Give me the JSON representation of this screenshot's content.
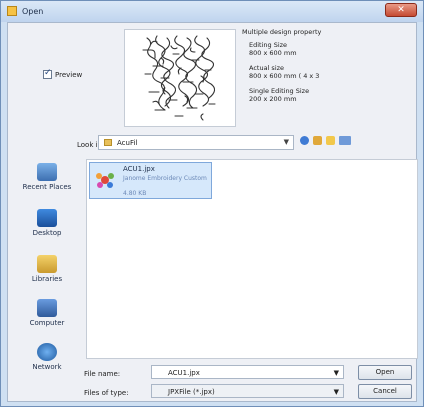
{
  "window": {
    "title": "Open",
    "close_label": "✕"
  },
  "preview": {
    "label": "Preview",
    "checked": true
  },
  "design_info": {
    "heading": "Multiple design property",
    "editing_size_label": "Editing Size",
    "editing_size_value": "800 x 600 mm",
    "actual_size_label": "Actual size",
    "actual_size_value": "800 x 600 mm ( 4 x 3",
    "single_size_label": "Single Editing Size",
    "single_size_value": "200 x 200 mm"
  },
  "lookin": {
    "label": "Look in:",
    "value": "AcuFil"
  },
  "places": [
    {
      "label": "Recent Places",
      "icon": "recent-places-icon"
    },
    {
      "label": "Desktop",
      "icon": "desktop-icon"
    },
    {
      "label": "Libraries",
      "icon": "libraries-icon"
    },
    {
      "label": "Computer",
      "icon": "computer-icon"
    },
    {
      "label": "Network",
      "icon": "network-icon"
    }
  ],
  "files": [
    {
      "name": "ACU1.jpx",
      "type": "Janome Embroidery Custom",
      "size": "4.80 KB"
    }
  ],
  "file_name": {
    "label": "File name:",
    "value": "ACU1.jpx"
  },
  "file_type": {
    "label": "Files of type:",
    "value": "JPXFile (*.jpx)"
  },
  "buttons": {
    "open": "Open",
    "cancel": "Cancel"
  },
  "colors": {
    "title_bar": "#c4d6ee",
    "selection": "#d6e8fb",
    "close": "#c54a32"
  }
}
